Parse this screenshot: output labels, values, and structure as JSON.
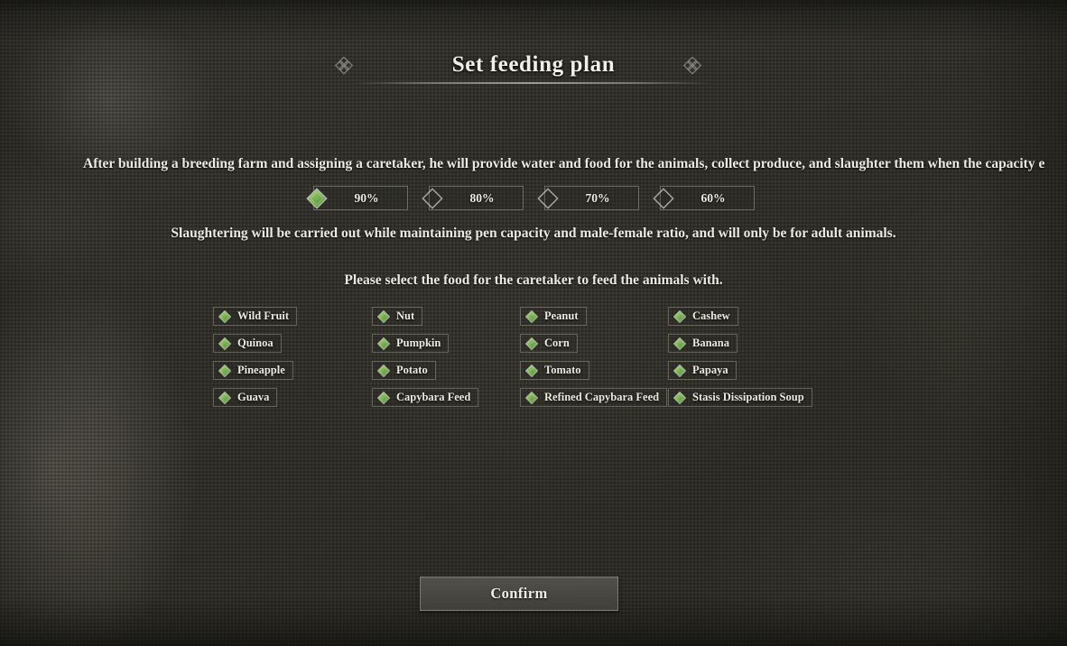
{
  "window": {
    "title": "Set feeding plan"
  },
  "ornaments": {
    "left_icon": "quatrefoil-ornament",
    "right_icon": "quatrefoil-ornament"
  },
  "description": {
    "intro": "After building a breeding farm and assigning a caretaker, he will provide water and food for the animals, collect produce, and slaughter them when the capacity e",
    "rule": "Slaughtering will be carried out while maintaining pen capacity and male-female ratio, and will only be for adult animals.",
    "prompt": "Please select the food for the caretaker to feed the animals with."
  },
  "capacity_options": [
    {
      "label": "90%",
      "value": 90,
      "selected": true
    },
    {
      "label": "80%",
      "value": 80,
      "selected": false
    },
    {
      "label": "70%",
      "value": 70,
      "selected": false
    },
    {
      "label": "60%",
      "value": 60,
      "selected": false
    }
  ],
  "food_options": [
    {
      "label": "Wild Fruit",
      "selected": true
    },
    {
      "label": "Nut",
      "selected": true
    },
    {
      "label": "Peanut",
      "selected": true
    },
    {
      "label": "Cashew",
      "selected": true
    },
    {
      "label": "Quinoa",
      "selected": true
    },
    {
      "label": "Pumpkin",
      "selected": true
    },
    {
      "label": "Corn",
      "selected": true
    },
    {
      "label": "Banana",
      "selected": true
    },
    {
      "label": "Pineapple",
      "selected": true
    },
    {
      "label": "Potato",
      "selected": true
    },
    {
      "label": "Tomato",
      "selected": true
    },
    {
      "label": "Papaya",
      "selected": true
    },
    {
      "label": "Guava",
      "selected": true
    },
    {
      "label": "Capybara Feed",
      "selected": true
    },
    {
      "label": "Refined Capybara Feed",
      "selected": true
    },
    {
      "label": "Stasis Dissipation Soup",
      "selected": true
    }
  ],
  "confirm": {
    "label": "Confirm"
  },
  "colors": {
    "diamond_fill_light": "#9fd07a",
    "diamond_fill_dark": "#4e8a3c",
    "diamond_outline": "#c9c5ba",
    "text": "#edeae2",
    "background": "#35342f",
    "panel_border": "#bab6ac"
  }
}
